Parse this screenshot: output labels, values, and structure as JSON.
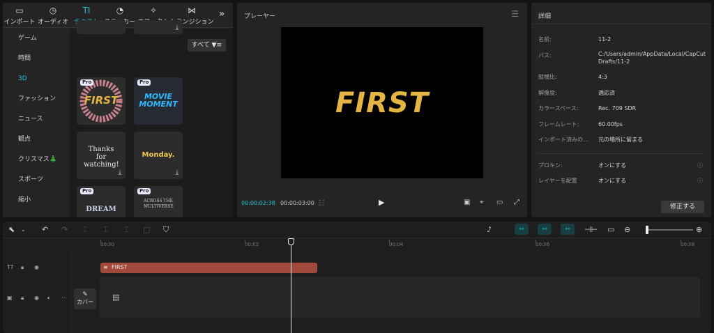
{
  "toolbar": {
    "tabs": [
      {
        "label": "インポート",
        "icon": "media-icon"
      },
      {
        "label": "オーディオ",
        "icon": "audio-icon"
      },
      {
        "label": "テキスト",
        "icon": "text-icon"
      },
      {
        "label": "ステッカー",
        "icon": "sticker-icon"
      },
      {
        "label": "エフェクト",
        "icon": "effect-icon"
      },
      {
        "label": "トランジション",
        "icon": "transition-icon"
      }
    ],
    "active_tab": "テキスト",
    "more_label": "»",
    "tab_icons": [
      "▭",
      "◷",
      "TI",
      "◔",
      "✧",
      "⋈"
    ]
  },
  "sidebar": {
    "items": [
      {
        "label": "ゲーム"
      },
      {
        "label": "時間"
      },
      {
        "label": "3D"
      },
      {
        "label": "ファッション"
      },
      {
        "label": "ニュース"
      },
      {
        "label": "観点"
      },
      {
        "label": "クリスマス🎄"
      },
      {
        "label": "スポーツ"
      },
      {
        "label": "縮小"
      }
    ],
    "active_item": "3D"
  },
  "templates": {
    "filter_label": "すべて",
    "filter_icon": "filter-icon",
    "items": [
      {
        "text": "FIRST",
        "badge": "Pro"
      },
      {
        "text": "MOVIE MOMENT",
        "badge": "Pro"
      },
      {
        "text": "Thanks for watching!",
        "badge": ""
      },
      {
        "text": "Monday.",
        "badge": ""
      },
      {
        "text": "DREAM",
        "badge": "Pro"
      },
      {
        "text": "ACROSS THE MULTIVERSE",
        "badge": "Pro"
      }
    ]
  },
  "player": {
    "title": "プレーヤー",
    "preview_text": "FIRST",
    "current_time": "00:00:02:38",
    "total_time": "00:00:03:00",
    "play_icon": "play-icon"
  },
  "details": {
    "title": "詳細",
    "rows": [
      {
        "label": "名前:",
        "value": "11-2"
      },
      {
        "label": "パス:",
        "value": "C:/Users/admin/AppData/Local/CapCut Drafts/11-2"
      },
      {
        "label": "縦横比:",
        "value": "4:3"
      },
      {
        "label": "解像度:",
        "value": "適応済"
      },
      {
        "label": "カラースペース:",
        "value": "Rec. 709 SDR"
      },
      {
        "label": "フレームレート:",
        "value": "60.00fps"
      },
      {
        "label": "インポート済みの…",
        "value": "元の場所に留まる"
      }
    ],
    "settings": [
      {
        "label": "プロキシ:",
        "value": "オンにする"
      },
      {
        "label": "レイヤーを配置",
        "value": "オンにする"
      }
    ],
    "fix_button": "修正する"
  },
  "timeline": {
    "ruler_ticks": [
      "00:00",
      "00:02",
      "00:04",
      "00:06",
      "00:08"
    ],
    "text_clip_label": "FIRST",
    "cover_label": "カバー"
  },
  "colors": {
    "accent": "#22c6d6",
    "text_clip": "#a14a3c"
  }
}
